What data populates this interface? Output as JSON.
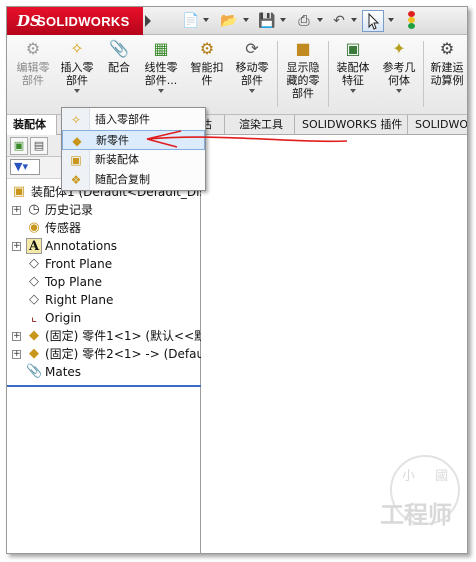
{
  "app": {
    "brand": "SOLIDWORKS"
  },
  "colors": {
    "brand_red": "#d80c22",
    "menu_hover": "#dcecfc",
    "annotation_red": "#e11d1d",
    "tree_line": "#3a6dc6"
  },
  "quick_access": {
    "new_icon": "new-document-icon",
    "open_icon": "open-folder-icon",
    "save_icon": "save-disk-icon",
    "print_icon": "print-icon",
    "undo_icon": "undo-icon",
    "select_icon": "select-pointer-icon",
    "rebuild_icon": "traffic-light-icon"
  },
  "toolbar": {
    "buttons": [
      {
        "label_l1": "编辑零",
        "label_l2": "部件"
      },
      {
        "label_l1": "插入零",
        "label_l2": "部件"
      },
      {
        "label_l1": "配合",
        "label_l2": ""
      },
      {
        "label_l1": "线性零",
        "label_l2": "部件..."
      },
      {
        "label_l1": "智能扣",
        "label_l2": "件"
      },
      {
        "label_l1": "移动零",
        "label_l2": "部件"
      },
      {
        "label_l1": "显示隐",
        "label_l2": "藏的零",
        "label_l3": "部件"
      },
      {
        "label_l1": "装配体",
        "label_l2": "特征"
      },
      {
        "label_l1": "参考几",
        "label_l2": "何体"
      },
      {
        "label_l1": "新建运",
        "label_l2": "动算例"
      }
    ]
  },
  "tabs": [
    {
      "label": "装配体"
    },
    {
      "label": "估"
    },
    {
      "label": "渲染工具"
    },
    {
      "label": "SOLIDWORKS 插件"
    },
    {
      "label": "SOLIDWO"
    }
  ],
  "dropdown": {
    "items": [
      {
        "label": "插入零部件"
      },
      {
        "label": "新零件"
      },
      {
        "label": "新装配体"
      },
      {
        "label": "随配合复制"
      }
    ]
  },
  "tree": {
    "root": "装配体1 (Default<Default_Dis",
    "items": [
      {
        "label": "历史记录"
      },
      {
        "label": "传感器"
      },
      {
        "label": "Annotations"
      },
      {
        "label": "Front Plane"
      },
      {
        "label": "Top Plane"
      },
      {
        "label": "Right Plane"
      },
      {
        "label": "Origin"
      },
      {
        "label": "(固定) 零件1<1> (默认<<默"
      },
      {
        "label": "(固定) 零件2<1> -> (Defau"
      },
      {
        "label": "Mates"
      }
    ]
  },
  "watermark": {
    "top": "小 國",
    "bottom": "工程师"
  }
}
